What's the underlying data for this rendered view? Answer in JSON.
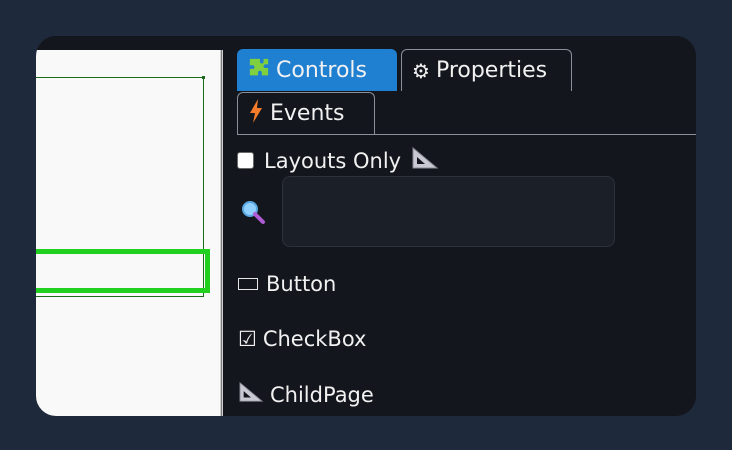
{
  "tabs": {
    "controls": {
      "label": "Controls",
      "icon": "puzzle-icon"
    },
    "properties": {
      "label": "Properties",
      "icon": "gear-icon"
    },
    "events": {
      "label": "Events",
      "icon": "lightning-icon"
    }
  },
  "filter": {
    "layouts_only_label": "Layouts Only",
    "layouts_only_checked": false
  },
  "search": {
    "value": "",
    "placeholder": ""
  },
  "controls": [
    {
      "label": "Button",
      "icon": "button-icon"
    },
    {
      "label": "CheckBox",
      "icon": "checkbox-icon"
    },
    {
      "label": "ChildPage",
      "icon": "triangle-ruler-icon"
    }
  ],
  "colors": {
    "accent": "#1f7fd1",
    "selection": "#22d11f",
    "outline": "#1b6b1b",
    "background": "#1e293b",
    "panel": "#13161c"
  }
}
